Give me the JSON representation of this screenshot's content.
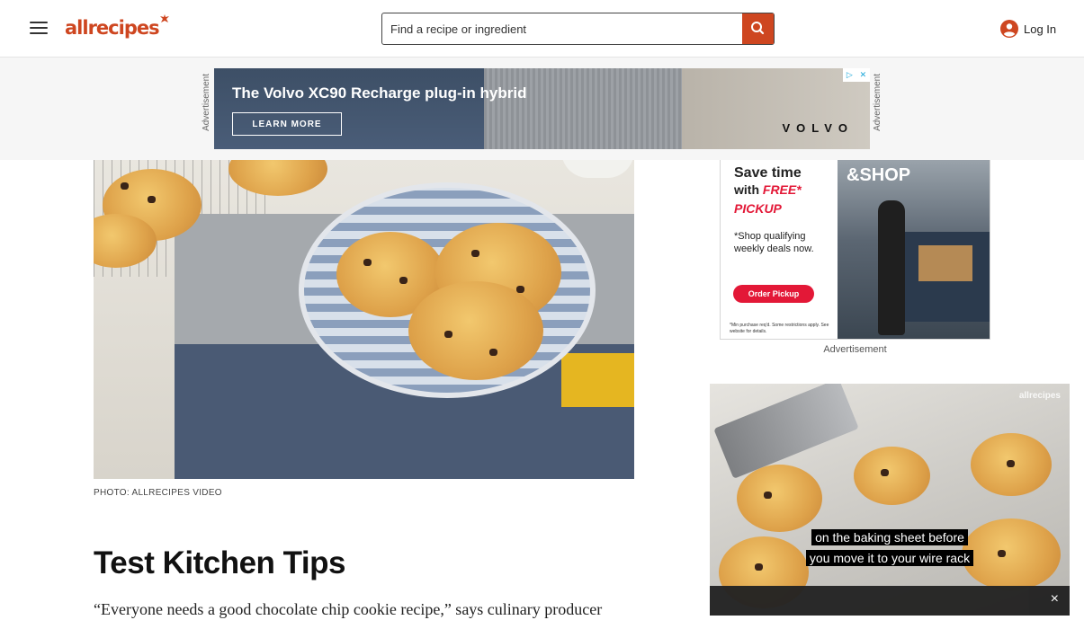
{
  "header": {
    "logo_text": "allrecipes",
    "search_placeholder": "Find a recipe or ingredient",
    "login_label": "Log In",
    "brand_color": "#ce4620"
  },
  "top_ad": {
    "label": "Advertisement",
    "headline": "The Volvo XC90 Recharge plug-in hybrid",
    "cta": "LEARN MORE",
    "brand": "VOLVO"
  },
  "article": {
    "photo_credit": "PHOTO: ALLRECIPES VIDEO",
    "section_title": "Test Kitchen Tips",
    "body_text": "“Everyone needs a good chocolate chip cookie recipe,” says culinary producer"
  },
  "side_ad": {
    "sign": "&SHOP",
    "headline_line1": "Save time",
    "headline_line2_prefix": "with ",
    "headline_line2_em": "FREE*",
    "headline_line3": "PICKUP",
    "subtext": "*Shop qualifying weekly deals now.",
    "button": "Order Pickup",
    "fine_print": "*Min purchase req'd. Some restrictions apply. See website for details.",
    "label": "Advertisement",
    "accent_color": "#e31837"
  },
  "video": {
    "watermark": "allrecipes",
    "subtitle_line1": "on the baking sheet before",
    "subtitle_line2": "you move it to your wire rack",
    "close_label": "×"
  }
}
